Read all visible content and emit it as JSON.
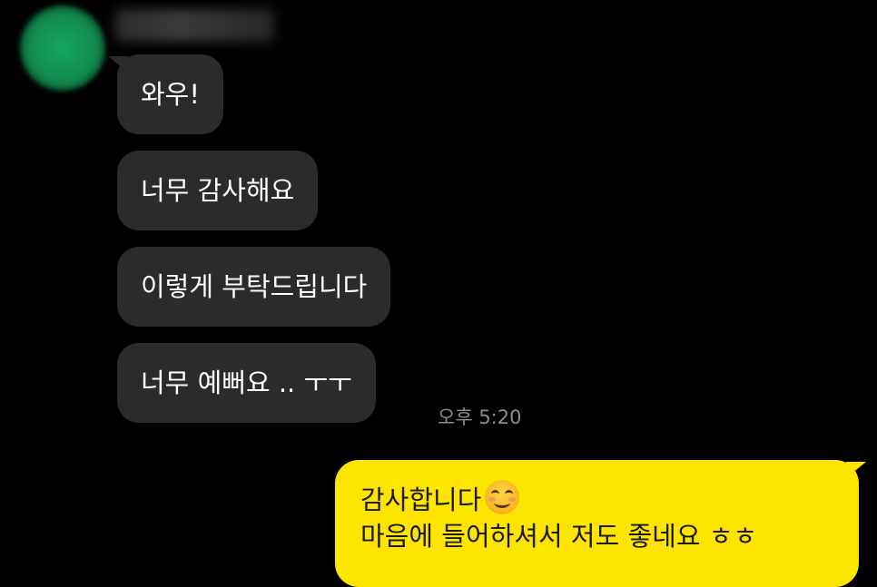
{
  "chat": {
    "sender_name": "",
    "incoming": [
      {
        "text": "와우!"
      },
      {
        "text": "너무 감사해요"
      },
      {
        "text": "이렇게 부탁드립니다"
      },
      {
        "text": "너무 예뻐요 .. ㅜㅜ"
      }
    ],
    "incoming_time": "오후 5:20",
    "outgoing": {
      "line1": "감사합니다",
      "emoji": "smiling-face-icon",
      "line2": "마음에 들어하셔서 저도 좋네요 ㅎㅎ"
    }
  },
  "colors": {
    "background": "#000000",
    "incoming_bubble": "#2b2b2b",
    "outgoing_bubble": "#fee500",
    "timestamp": "#8c8c8c"
  }
}
